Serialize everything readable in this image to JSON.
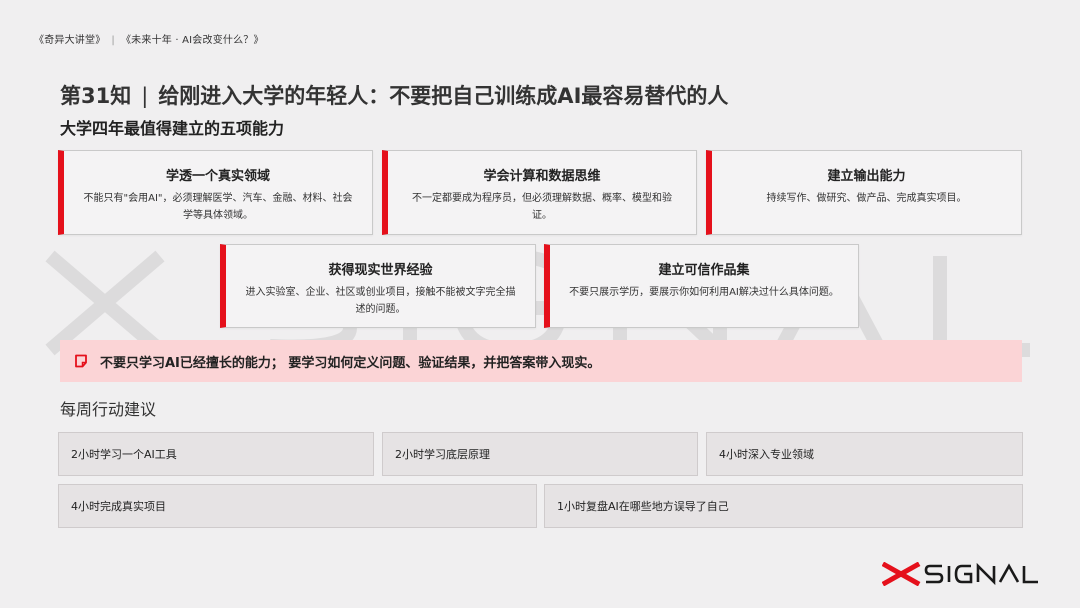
{
  "topbar": {
    "series": "《奇异大讲堂》",
    "separator": "|",
    "episode": "《未来十年 · AI会改变什么？》"
  },
  "header": {
    "title_number": "第31知",
    "title_pipe": "|",
    "title_text": "给刚进入大学的年轻人：不要把自己训练成AI最容易替代的人",
    "subtitle": "大学四年最值得建立的五项能力"
  },
  "abilities": [
    {
      "title": "学透一个真实领域",
      "desc": "不能只有\"会用AI\"，必须理解医学、汽车、金融、材料、社会学等具体领域。"
    },
    {
      "title": "学会计算和数据思维",
      "desc": "不一定都要成为程序员，但必须理解数据、概率、模型和验证。"
    },
    {
      "title": "建立输出能力",
      "desc": "持续写作、做研究、做产品、完成真实项目。"
    },
    {
      "title": "获得现实世界经验",
      "desc": "进入实验室、企业、社区或创业项目，接触不能被文字完全描述的问题。"
    },
    {
      "title": "建立可信作品集",
      "desc": "不要只展示学历，要展示你如何利用AI解决过什么具体问题。"
    }
  ],
  "callout": {
    "icon": "note-icon",
    "text": "不要只学习AI已经擅长的能力； 要学习如何定义问题、验证结果，并把答案带入现实。"
  },
  "weekly": {
    "title": "每周行动建议",
    "items": [
      "2小时学习一个AI工具",
      "2小时学习底层原理",
      "4小时深入专业领域",
      "4小时完成真实项目",
      "1小时复盘AI在哪些地方误导了自己"
    ]
  },
  "brand": {
    "logo_text": "SIGNAL",
    "accent": "#e5101b"
  }
}
